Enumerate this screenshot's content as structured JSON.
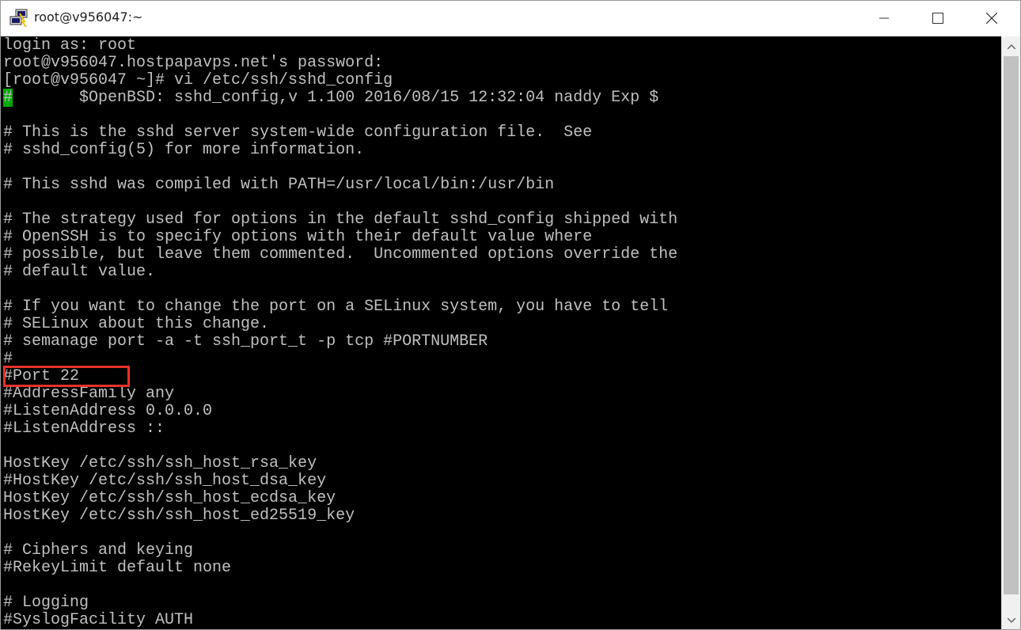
{
  "window": {
    "title": "root@v956047:~",
    "icons": {
      "app": "putty-icon",
      "minimize": "minimize-icon",
      "maximize": "maximize-icon",
      "close": "close-icon",
      "scroll_up": "chevron-up-icon",
      "scroll_down": "chevron-down-icon"
    }
  },
  "terminal": {
    "colors": {
      "background": "#000000",
      "foreground": "#c0c0c0",
      "cursor": "#00aa00",
      "highlight": "#e5322b"
    },
    "lines": [
      "login as: root",
      "root@v956047.hostpapavps.net's password:",
      "[root@v956047 ~]# vi /etc/ssh/sshd_config",
      "#       $OpenBSD: sshd_config,v 1.100 2016/08/15 12:32:04 naddy Exp $",
      "",
      "# This is the sshd server system-wide configuration file.  See",
      "# sshd_config(5) for more information.",
      "",
      "# This sshd was compiled with PATH=/usr/local/bin:/usr/bin",
      "",
      "# The strategy used for options in the default sshd_config shipped with",
      "# OpenSSH is to specify options with their default value where",
      "# possible, but leave them commented.  Uncommented options override the",
      "# default value.",
      "",
      "# If you want to change the port on a SELinux system, you have to tell",
      "# SELinux about this change.",
      "# semanage port -a -t ssh_port_t -p tcp #PORTNUMBER",
      "#",
      "#Port 22",
      "#AddressFamily any",
      "#ListenAddress 0.0.0.0",
      "#ListenAddress ::",
      "",
      "HostKey /etc/ssh/ssh_host_rsa_key",
      "#HostKey /etc/ssh/ssh_host_dsa_key",
      "HostKey /etc/ssh/ssh_host_ecdsa_key",
      "HostKey /etc/ssh/ssh_host_ed25519_key",
      "",
      "# Ciphers and keying",
      "#RekeyLimit default none",
      "",
      "# Logging",
      "#SyslogFacility AUTH"
    ],
    "cursor_line": 3,
    "highlighted_line": 19
  }
}
